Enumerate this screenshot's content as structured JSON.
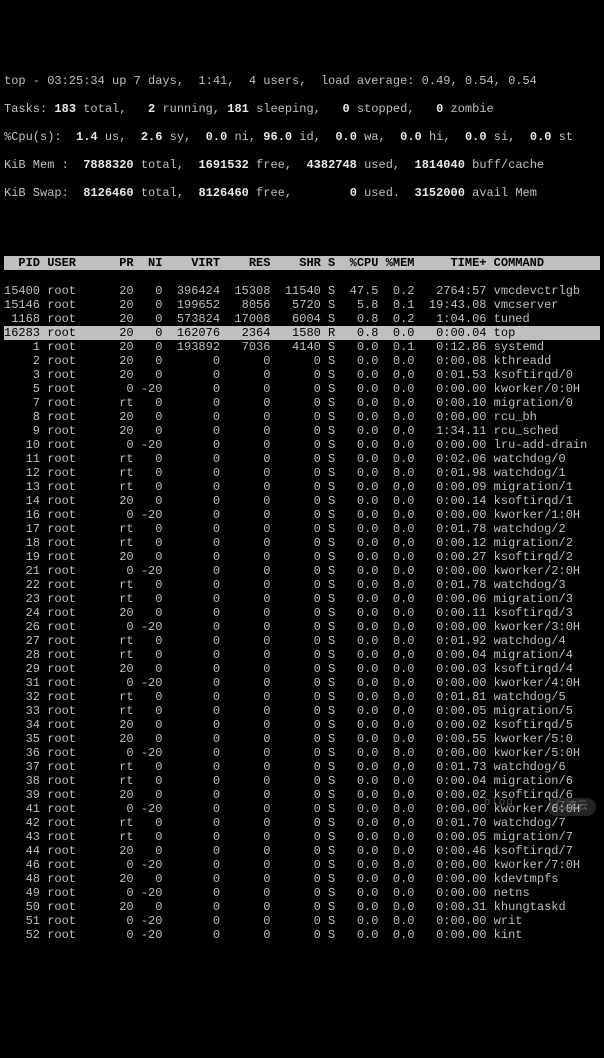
{
  "summary": {
    "line1_a": "top - 03:25:34 up 7 days,  1:41,  4 users,  load average: 0.49, 0.54, 0.54",
    "line2_pre": "Tasks: ",
    "line2_total": "183",
    "line2_mid1": " total,   ",
    "line2_running": "2",
    "line2_mid2": " running, ",
    "line2_sleep": "181",
    "line2_mid3": " sleeping,   ",
    "line2_stopped": "0",
    "line2_mid4": " stopped,   ",
    "line2_zombie": "0",
    "line2_end": " zombie",
    "line3_pre": "%Cpu(s):  ",
    "line3_us": "1.4",
    "line3_m1": " us,  ",
    "line3_sy": "2.6",
    "line3_m2": " sy,  ",
    "line3_ni": "0.0",
    "line3_m3": " ni, ",
    "line3_id": "96.0",
    "line3_m4": " id,  ",
    "line3_wa": "0.0",
    "line3_m5": " wa,  ",
    "line3_hi": "0.0",
    "line3_m6": " hi,  ",
    "line3_si": "0.0",
    "line3_m7": " si,  ",
    "line3_st": "0.0",
    "line3_end": " st",
    "line4_pre": "KiB Mem : ",
    "line4_total": " 7888320",
    "line4_m1": " total,  ",
    "line4_free": "1691532",
    "line4_m2": " free,  ",
    "line4_used": "4382748",
    "line4_m3": " used,  ",
    "line4_buff": "1814040",
    "line4_end": " buff/cache",
    "line5_pre": "KiB Swap: ",
    "line5_total": " 8126460",
    "line5_m1": " total,  ",
    "line5_free": "8126460",
    "line5_m2": " free,        ",
    "line5_used": "0",
    "line5_m3": " used.  ",
    "line5_avail": "3152000",
    "line5_end": " avail Mem"
  },
  "header": "  PID USER      PR  NI    VIRT    RES    SHR S  %CPU %MEM     TIME+ COMMAND     ",
  "rows": [
    {
      "pid": "15400",
      "user": "root",
      "pr": "20",
      "ni": "0",
      "virt": "396424",
      "res": "15308",
      "shr": "11540",
      "s": "S",
      "cpu": "47.5",
      "mem": "0.2",
      "time": "2764:57",
      "cmd": "vmcdevctrlgb",
      "hl": false
    },
    {
      "pid": "15146",
      "user": "root",
      "pr": "20",
      "ni": "0",
      "virt": "199652",
      "res": "8056",
      "shr": "5720",
      "s": "S",
      "cpu": "5.8",
      "mem": "0.1",
      "time": "19:43.08",
      "cmd": "vmcserver",
      "hl": false
    },
    {
      "pid": "1168",
      "user": "root",
      "pr": "20",
      "ni": "0",
      "virt": "573824",
      "res": "17008",
      "shr": "6004",
      "s": "S",
      "cpu": "0.8",
      "mem": "0.2",
      "time": "1:04.06",
      "cmd": "tuned",
      "hl": false
    },
    {
      "pid": "16283",
      "user": "root",
      "pr": "20",
      "ni": "0",
      "virt": "162076",
      "res": "2364",
      "shr": "1580",
      "s": "R",
      "cpu": "0.8",
      "mem": "0.0",
      "time": "0:00.04",
      "cmd": "top",
      "hl": true
    },
    {
      "pid": "1",
      "user": "root",
      "pr": "20",
      "ni": "0",
      "virt": "193892",
      "res": "7036",
      "shr": "4140",
      "s": "S",
      "cpu": "0.0",
      "mem": "0.1",
      "time": "0:12.86",
      "cmd": "systemd",
      "hl": false
    },
    {
      "pid": "2",
      "user": "root",
      "pr": "20",
      "ni": "0",
      "virt": "0",
      "res": "0",
      "shr": "0",
      "s": "S",
      "cpu": "0.0",
      "mem": "0.0",
      "time": "0:00.08",
      "cmd": "kthreadd",
      "hl": false
    },
    {
      "pid": "3",
      "user": "root",
      "pr": "20",
      "ni": "0",
      "virt": "0",
      "res": "0",
      "shr": "0",
      "s": "S",
      "cpu": "0.0",
      "mem": "0.0",
      "time": "0:01.53",
      "cmd": "ksoftirqd/0",
      "hl": false
    },
    {
      "pid": "5",
      "user": "root",
      "pr": "0",
      "ni": "-20",
      "virt": "0",
      "res": "0",
      "shr": "0",
      "s": "S",
      "cpu": "0.0",
      "mem": "0.0",
      "time": "0:00.00",
      "cmd": "kworker/0:0H",
      "hl": false
    },
    {
      "pid": "7",
      "user": "root",
      "pr": "rt",
      "ni": "0",
      "virt": "0",
      "res": "0",
      "shr": "0",
      "s": "S",
      "cpu": "0.0",
      "mem": "0.0",
      "time": "0:00.10",
      "cmd": "migration/0",
      "hl": false
    },
    {
      "pid": "8",
      "user": "root",
      "pr": "20",
      "ni": "0",
      "virt": "0",
      "res": "0",
      "shr": "0",
      "s": "S",
      "cpu": "0.0",
      "mem": "0.0",
      "time": "0:00.00",
      "cmd": "rcu_bh",
      "hl": false
    },
    {
      "pid": "9",
      "user": "root",
      "pr": "20",
      "ni": "0",
      "virt": "0",
      "res": "0",
      "shr": "0",
      "s": "S",
      "cpu": "0.0",
      "mem": "0.0",
      "time": "1:34.11",
      "cmd": "rcu_sched",
      "hl": false
    },
    {
      "pid": "10",
      "user": "root",
      "pr": "0",
      "ni": "-20",
      "virt": "0",
      "res": "0",
      "shr": "0",
      "s": "S",
      "cpu": "0.0",
      "mem": "0.0",
      "time": "0:00.00",
      "cmd": "lru-add-drain",
      "hl": false
    },
    {
      "pid": "11",
      "user": "root",
      "pr": "rt",
      "ni": "0",
      "virt": "0",
      "res": "0",
      "shr": "0",
      "s": "S",
      "cpu": "0.0",
      "mem": "0.0",
      "time": "0:02.06",
      "cmd": "watchdog/0",
      "hl": false
    },
    {
      "pid": "12",
      "user": "root",
      "pr": "rt",
      "ni": "0",
      "virt": "0",
      "res": "0",
      "shr": "0",
      "s": "S",
      "cpu": "0.0",
      "mem": "0.0",
      "time": "0:01.98",
      "cmd": "watchdog/1",
      "hl": false
    },
    {
      "pid": "13",
      "user": "root",
      "pr": "rt",
      "ni": "0",
      "virt": "0",
      "res": "0",
      "shr": "0",
      "s": "S",
      "cpu": "0.0",
      "mem": "0.0",
      "time": "0:00.09",
      "cmd": "migration/1",
      "hl": false
    },
    {
      "pid": "14",
      "user": "root",
      "pr": "20",
      "ni": "0",
      "virt": "0",
      "res": "0",
      "shr": "0",
      "s": "S",
      "cpu": "0.0",
      "mem": "0.0",
      "time": "0:00.14",
      "cmd": "ksoftirqd/1",
      "hl": false
    },
    {
      "pid": "16",
      "user": "root",
      "pr": "0",
      "ni": "-20",
      "virt": "0",
      "res": "0",
      "shr": "0",
      "s": "S",
      "cpu": "0.0",
      "mem": "0.0",
      "time": "0:00.00",
      "cmd": "kworker/1:0H",
      "hl": false
    },
    {
      "pid": "17",
      "user": "root",
      "pr": "rt",
      "ni": "0",
      "virt": "0",
      "res": "0",
      "shr": "0",
      "s": "S",
      "cpu": "0.0",
      "mem": "0.0",
      "time": "0:01.78",
      "cmd": "watchdog/2",
      "hl": false
    },
    {
      "pid": "18",
      "user": "root",
      "pr": "rt",
      "ni": "0",
      "virt": "0",
      "res": "0",
      "shr": "0",
      "s": "S",
      "cpu": "0.0",
      "mem": "0.0",
      "time": "0:00.12",
      "cmd": "migration/2",
      "hl": false
    },
    {
      "pid": "19",
      "user": "root",
      "pr": "20",
      "ni": "0",
      "virt": "0",
      "res": "0",
      "shr": "0",
      "s": "S",
      "cpu": "0.0",
      "mem": "0.0",
      "time": "0:00.27",
      "cmd": "ksoftirqd/2",
      "hl": false
    },
    {
      "pid": "21",
      "user": "root",
      "pr": "0",
      "ni": "-20",
      "virt": "0",
      "res": "0",
      "shr": "0",
      "s": "S",
      "cpu": "0.0",
      "mem": "0.0",
      "time": "0:00.00",
      "cmd": "kworker/2:0H",
      "hl": false
    },
    {
      "pid": "22",
      "user": "root",
      "pr": "rt",
      "ni": "0",
      "virt": "0",
      "res": "0",
      "shr": "0",
      "s": "S",
      "cpu": "0.0",
      "mem": "0.0",
      "time": "0:01.78",
      "cmd": "watchdog/3",
      "hl": false
    },
    {
      "pid": "23",
      "user": "root",
      "pr": "rt",
      "ni": "0",
      "virt": "0",
      "res": "0",
      "shr": "0",
      "s": "S",
      "cpu": "0.0",
      "mem": "0.0",
      "time": "0:00.06",
      "cmd": "migration/3",
      "hl": false
    },
    {
      "pid": "24",
      "user": "root",
      "pr": "20",
      "ni": "0",
      "virt": "0",
      "res": "0",
      "shr": "0",
      "s": "S",
      "cpu": "0.0",
      "mem": "0.0",
      "time": "0:00.11",
      "cmd": "ksoftirqd/3",
      "hl": false
    },
    {
      "pid": "26",
      "user": "root",
      "pr": "0",
      "ni": "-20",
      "virt": "0",
      "res": "0",
      "shr": "0",
      "s": "S",
      "cpu": "0.0",
      "mem": "0.0",
      "time": "0:00.00",
      "cmd": "kworker/3:0H",
      "hl": false
    },
    {
      "pid": "27",
      "user": "root",
      "pr": "rt",
      "ni": "0",
      "virt": "0",
      "res": "0",
      "shr": "0",
      "s": "S",
      "cpu": "0.0",
      "mem": "0.0",
      "time": "0:01.92",
      "cmd": "watchdog/4",
      "hl": false
    },
    {
      "pid": "28",
      "user": "root",
      "pr": "rt",
      "ni": "0",
      "virt": "0",
      "res": "0",
      "shr": "0",
      "s": "S",
      "cpu": "0.0",
      "mem": "0.0",
      "time": "0:00.04",
      "cmd": "migration/4",
      "hl": false
    },
    {
      "pid": "29",
      "user": "root",
      "pr": "20",
      "ni": "0",
      "virt": "0",
      "res": "0",
      "shr": "0",
      "s": "S",
      "cpu": "0.0",
      "mem": "0.0",
      "time": "0:00.03",
      "cmd": "ksoftirqd/4",
      "hl": false
    },
    {
      "pid": "31",
      "user": "root",
      "pr": "0",
      "ni": "-20",
      "virt": "0",
      "res": "0",
      "shr": "0",
      "s": "S",
      "cpu": "0.0",
      "mem": "0.0",
      "time": "0:00.00",
      "cmd": "kworker/4:0H",
      "hl": false
    },
    {
      "pid": "32",
      "user": "root",
      "pr": "rt",
      "ni": "0",
      "virt": "0",
      "res": "0",
      "shr": "0",
      "s": "S",
      "cpu": "0.0",
      "mem": "0.0",
      "time": "0:01.81",
      "cmd": "watchdog/5",
      "hl": false
    },
    {
      "pid": "33",
      "user": "root",
      "pr": "rt",
      "ni": "0",
      "virt": "0",
      "res": "0",
      "shr": "0",
      "s": "S",
      "cpu": "0.0",
      "mem": "0.0",
      "time": "0:00.05",
      "cmd": "migration/5",
      "hl": false
    },
    {
      "pid": "34",
      "user": "root",
      "pr": "20",
      "ni": "0",
      "virt": "0",
      "res": "0",
      "shr": "0",
      "s": "S",
      "cpu": "0.0",
      "mem": "0.0",
      "time": "0:00.02",
      "cmd": "ksoftirqd/5",
      "hl": false
    },
    {
      "pid": "35",
      "user": "root",
      "pr": "20",
      "ni": "0",
      "virt": "0",
      "res": "0",
      "shr": "0",
      "s": "S",
      "cpu": "0.0",
      "mem": "0.0",
      "time": "0:00.55",
      "cmd": "kworker/5:0",
      "hl": false
    },
    {
      "pid": "36",
      "user": "root",
      "pr": "0",
      "ni": "-20",
      "virt": "0",
      "res": "0",
      "shr": "0",
      "s": "S",
      "cpu": "0.0",
      "mem": "0.0",
      "time": "0:00.00",
      "cmd": "kworker/5:0H",
      "hl": false
    },
    {
      "pid": "37",
      "user": "root",
      "pr": "rt",
      "ni": "0",
      "virt": "0",
      "res": "0",
      "shr": "0",
      "s": "S",
      "cpu": "0.0",
      "mem": "0.0",
      "time": "0:01.73",
      "cmd": "watchdog/6",
      "hl": false
    },
    {
      "pid": "38",
      "user": "root",
      "pr": "rt",
      "ni": "0",
      "virt": "0",
      "res": "0",
      "shr": "0",
      "s": "S",
      "cpu": "0.0",
      "mem": "0.0",
      "time": "0:00.04",
      "cmd": "migration/6",
      "hl": false
    },
    {
      "pid": "39",
      "user": "root",
      "pr": "20",
      "ni": "0",
      "virt": "0",
      "res": "0",
      "shr": "0",
      "s": "S",
      "cpu": "0.0",
      "mem": "0.0",
      "time": "0:00.02",
      "cmd": "ksoftirqd/6",
      "hl": false
    },
    {
      "pid": "41",
      "user": "root",
      "pr": "0",
      "ni": "-20",
      "virt": "0",
      "res": "0",
      "shr": "0",
      "s": "S",
      "cpu": "0.0",
      "mem": "0.0",
      "time": "0:00.00",
      "cmd": "kworker/6:0H",
      "hl": false
    },
    {
      "pid": "42",
      "user": "root",
      "pr": "rt",
      "ni": "0",
      "virt": "0",
      "res": "0",
      "shr": "0",
      "s": "S",
      "cpu": "0.0",
      "mem": "0.0",
      "time": "0:01.70",
      "cmd": "watchdog/7",
      "hl": false
    },
    {
      "pid": "43",
      "user": "root",
      "pr": "rt",
      "ni": "0",
      "virt": "0",
      "res": "0",
      "shr": "0",
      "s": "S",
      "cpu": "0.0",
      "mem": "0.0",
      "time": "0:00.05",
      "cmd": "migration/7",
      "hl": false
    },
    {
      "pid": "44",
      "user": "root",
      "pr": "20",
      "ni": "0",
      "virt": "0",
      "res": "0",
      "shr": "0",
      "s": "S",
      "cpu": "0.0",
      "mem": "0.0",
      "time": "0:00.46",
      "cmd": "ksoftirqd/7",
      "hl": false
    },
    {
      "pid": "46",
      "user": "root",
      "pr": "0",
      "ni": "-20",
      "virt": "0",
      "res": "0",
      "shr": "0",
      "s": "S",
      "cpu": "0.0",
      "mem": "0.0",
      "time": "0:00.00",
      "cmd": "kworker/7:0H",
      "hl": false
    },
    {
      "pid": "48",
      "user": "root",
      "pr": "20",
      "ni": "0",
      "virt": "0",
      "res": "0",
      "shr": "0",
      "s": "S",
      "cpu": "0.0",
      "mem": "0.0",
      "time": "0:00.00",
      "cmd": "kdevtmpfs",
      "hl": false
    },
    {
      "pid": "49",
      "user": "root",
      "pr": "0",
      "ni": "-20",
      "virt": "0",
      "res": "0",
      "shr": "0",
      "s": "S",
      "cpu": "0.0",
      "mem": "0.0",
      "time": "0:00.00",
      "cmd": "netns",
      "hl": false
    },
    {
      "pid": "50",
      "user": "root",
      "pr": "20",
      "ni": "0",
      "virt": "0",
      "res": "0",
      "shr": "0",
      "s": "S",
      "cpu": "0.0",
      "mem": "0.0",
      "time": "0:00.31",
      "cmd": "khungtaskd",
      "hl": false
    },
    {
      "pid": "51",
      "user": "root",
      "pr": "0",
      "ni": "-20",
      "virt": "0",
      "res": "0",
      "shr": "0",
      "s": "S",
      "cpu": "0.0",
      "mem": "0.0",
      "time": "0:00.00",
      "cmd": "writ",
      "hl": false
    },
    {
      "pid": "52",
      "user": "root",
      "pr": "0",
      "ni": "-20",
      "virt": "0",
      "res": "0",
      "shr": "0",
      "s": "S",
      "cpu": "0.0",
      "mem": "0.0",
      "time": "0:00.00",
      "cmd": "kint",
      "hl": false
    }
  ],
  "watermark": "亿速云",
  "faded": "blog"
}
